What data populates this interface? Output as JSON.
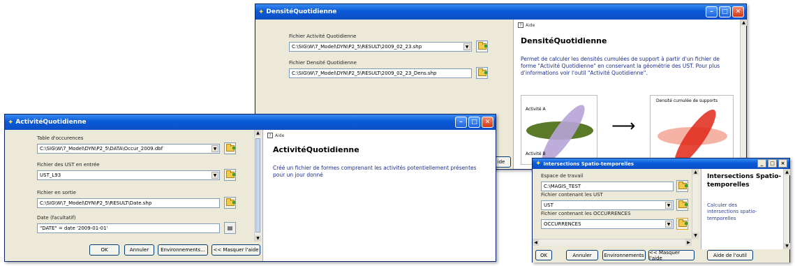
{
  "window_densite": {
    "title": "DensitéQuotidienne",
    "label_fichier_activite": "Fichier Activité Quotidienne",
    "value_fichier_activite": "C:\\SIG\\W\\7_Model\\DYN\\P2_5\\RESULT\\2009_02_23.shp",
    "label_fichier_densite": "Fichier Densité Quotidienne",
    "value_fichier_densite": "C:\\SIG\\W\\7_Model\\DYN\\P2_5\\RESULT\\2009_02_23_Dens.shp",
    "help_tab": "Aide",
    "help_title": "DensitéQuotidienne",
    "help_text": "Permet de calculer les densités cumulées de support à partir d'un fichier de forme \"Activité Quotidienne\" en conservant la géométrie des UST. Pour plus d'informations voir l'outil \"Activité Quotidienne\".",
    "diagram_label_a": "Activité A",
    "diagram_label_b": "Activité B",
    "diagram_result_title": "Densité cumulée de supports",
    "partial_button": "ide"
  },
  "window_activite": {
    "title": "ActivitéQuotidienne",
    "label_table": "Table d'occurences",
    "value_table": "C:\\SIG\\W\\7_Model\\DYN\\P2_5\\DATA\\Occur_2009.dbf",
    "label_ust": "Fichier des UST en entrée",
    "value_ust": "UST_L93",
    "label_sortie": "Fichier en sortie",
    "value_sortie": "C:\\SIG\\W\\7_Model\\DYN\\P2_5\\RESULT\\Date.shp",
    "label_date": "Date (facultatif)",
    "value_date": "\"DATE\" = date '2009-01-01'",
    "help_tab": "Aide",
    "help_title": "ActivitéQuotidienne",
    "help_text": "Créé un fichier de formes comprenant les activités potentiellement présentes pour un jour donné",
    "btn_ok": "OK",
    "btn_annuler": "Annuler",
    "btn_env": "Environnements...",
    "btn_masquer": "<< Masquer l'aide"
  },
  "window_intersections": {
    "title": "Intersections Spatio-temporelles",
    "label_espace": "Espace de travail",
    "value_espace": "C:\\MAGIS_TEST",
    "label_ust": "Fichier contenant les UST",
    "value_ust": "UST",
    "label_occ": "Fichier contenant les OCCURRENCES",
    "value_occ": "OCCURRENCES",
    "help_title": "Intersections Spatio-temporelles",
    "help_text": "Calculer des intersections spatio-temporelles",
    "btn_ok": "OK",
    "btn_annuler": "Annuler",
    "btn_env": "Environnements",
    "btn_masquer": "<< Masquer l'aide",
    "btn_aide_outil": "Aide de l'outil"
  },
  "icons": [
    "app-icon",
    "folder-icon",
    "dropdown-arrow-icon",
    "sql-icon",
    "help-page-icon",
    "minimize-icon",
    "maximize-icon",
    "close-icon",
    "arrow-right-icon"
  ],
  "colors": {
    "titlebar": "#0a5ad8",
    "help_text": "#1e2f8a",
    "dialog_bg": "#ece9d8",
    "ellipse_green": "#5a7a2a",
    "ellipse_purple": "#b7a3d6",
    "ellipse_red": "#e02818"
  }
}
